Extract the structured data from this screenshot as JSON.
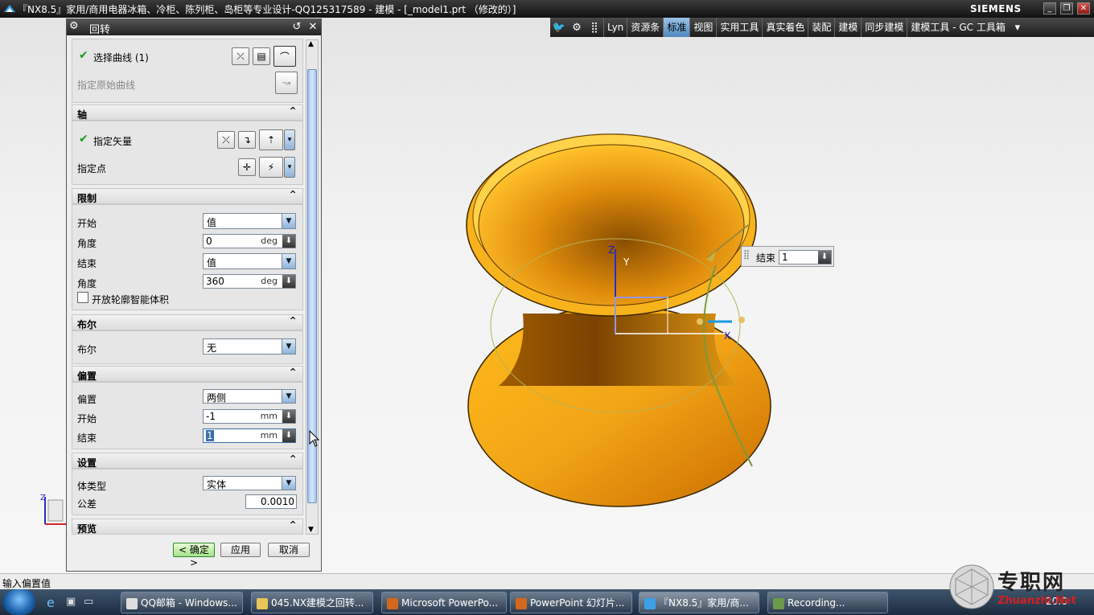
{
  "window": {
    "title": "『NX8.5』家用/商用电器冰箱、冷柜、陈列柜、岛柜等专业设计-QQ125317589 - 建模 - [_model1.prt （修改的）]",
    "brand": "SIEMENS"
  },
  "toolbar": {
    "items": [
      "Lyn",
      "资源条",
      "标准",
      "视图",
      "实用工具",
      "真实着色",
      "装配",
      "建模",
      "同步建模",
      "建模工具 - GC 工具箱"
    ],
    "active": "标准"
  },
  "dialog": {
    "title": "回转",
    "select_curve": "选择曲线 (1)",
    "origin_curve": "指定原始曲线",
    "axis": {
      "header": "轴",
      "vector": "指定矢量",
      "point": "指定点"
    },
    "limits": {
      "header": "限制",
      "start_label": "开始",
      "start_value": "值",
      "angle1_label": "角度",
      "angle1_value": "0",
      "angle1_unit": "deg",
      "end_label": "结束",
      "end_value": "值",
      "angle2_label": "角度",
      "angle2_value": "360",
      "angle2_unit": "deg",
      "open_profile": "开放轮廓智能体积"
    },
    "boolean": {
      "header": "布尔",
      "label": "布尔",
      "value": "无"
    },
    "offset": {
      "header": "偏置",
      "label": "偏置",
      "value": "两侧",
      "start_label": "开始",
      "start_value": "-1",
      "start_unit": "mm",
      "end_label": "结束",
      "end_value": "1",
      "end_unit": "mm"
    },
    "settings": {
      "header": "设置",
      "body_type_label": "体类型",
      "body_type_value": "实体",
      "tolerance_label": "公差",
      "tolerance_value": "0.0010"
    },
    "preview": {
      "header": "预览"
    },
    "buttons": {
      "ok": "< 确定 >",
      "apply": "应用",
      "cancel": "取消"
    }
  },
  "viewport": {
    "end_label": "结束",
    "end_value": "1",
    "axis_x": "X",
    "axis_y": "Y",
    "axis_z": "Z",
    "triad_z": "Z",
    "model_color": "#f3a516"
  },
  "status": {
    "prompt": "输入偏置值"
  },
  "taskbar": {
    "items": [
      "QQ邮箱 - Windows...",
      "045.NX建模之回转...",
      "Microsoft PowerPo...",
      "PowerPoint 幻灯片...",
      "『NX8.5』家用/商...",
      "Recording..."
    ],
    "clock": "20:0"
  },
  "watermark": {
    "text": "专职网",
    "url": "Zhuanzhi.Net"
  }
}
